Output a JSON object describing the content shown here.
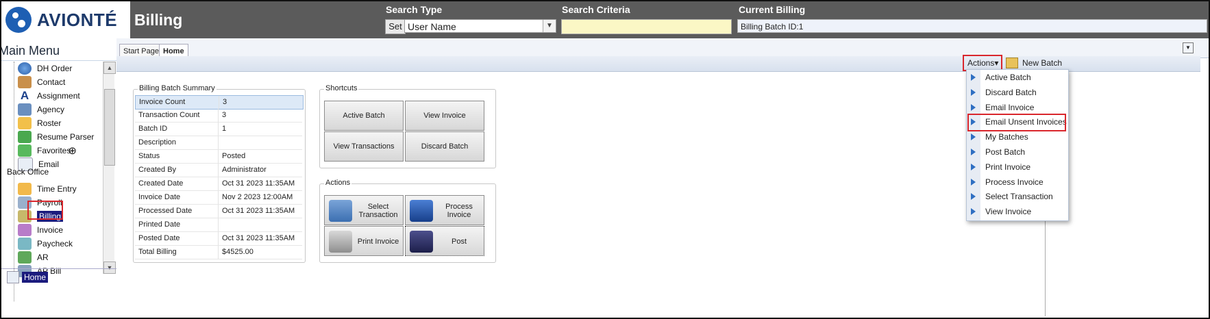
{
  "header": {
    "logo_text": "AVIONTÉ",
    "page_title": "Billing",
    "search_type_label": "Search Type",
    "search_criteria_label": "Search Criteria",
    "current_billing_label": "Current Billing",
    "set_label": "Set",
    "search_type_value": "User Name",
    "current_billing_value": "Billing Batch ID:1"
  },
  "left_menu": {
    "title": "Main Menu",
    "items": [
      {
        "label": "DH Order",
        "icon": "globe-icon"
      },
      {
        "label": "Contact",
        "icon": "contact-icon"
      },
      {
        "label": "Assignment",
        "icon": "assignment-icon"
      },
      {
        "label": "Agency",
        "icon": "agency-icon"
      },
      {
        "label": "Roster",
        "icon": "roster-icon"
      },
      {
        "label": "Resume Parser",
        "icon": "resume-parser-icon"
      },
      {
        "label": "Favorites",
        "icon": "favorites-icon"
      },
      {
        "label": "Email",
        "icon": "email-icon"
      }
    ],
    "group_label": "Back Office",
    "back_office_items": [
      {
        "label": "Time Entry",
        "icon": "time-entry-icon"
      },
      {
        "label": "Payroll",
        "icon": "payroll-icon"
      },
      {
        "label": "Billing",
        "icon": "billing-icon"
      },
      {
        "label": "Invoice",
        "icon": "invoice-icon"
      },
      {
        "label": "Paycheck",
        "icon": "paycheck-icon"
      },
      {
        "label": "AR",
        "icon": "ar-icon"
      },
      {
        "label": "AP Bill",
        "icon": "ap-bill-icon"
      }
    ],
    "home_label": "Home"
  },
  "tabs": [
    {
      "label": "Start Page"
    },
    {
      "label": "Home"
    }
  ],
  "toolbar": {
    "actions_label": "Actions",
    "new_batch_label": "New Batch"
  },
  "summary": {
    "title": "Billing Batch Summary",
    "rows": [
      {
        "key": "Invoice Count",
        "value": "3"
      },
      {
        "key": "Transaction Count",
        "value": "3"
      },
      {
        "key": "Batch ID",
        "value": "1"
      },
      {
        "key": "Description",
        "value": ""
      },
      {
        "key": "Status",
        "value": "Posted"
      },
      {
        "key": "Created By",
        "value": "Administrator"
      },
      {
        "key": "Created Date",
        "value": "Oct 31 2023 11:35AM"
      },
      {
        "key": "Invoice Date",
        "value": "Nov  2 2023 12:00AM"
      },
      {
        "key": "Processed Date",
        "value": "Oct 31 2023 11:35AM"
      },
      {
        "key": "Printed Date",
        "value": ""
      },
      {
        "key": "Posted Date",
        "value": "Oct 31 2023 11:35AM"
      },
      {
        "key": "Total Billing",
        "value": "$4525.00"
      }
    ]
  },
  "shortcuts": {
    "title": "Shortcuts",
    "buttons": [
      "Active Batch",
      "View Invoice",
      "View Transactions",
      "Discard Batch"
    ]
  },
  "actions_panel": {
    "title": "Actions",
    "buttons": [
      "Select Transaction",
      "Process Invoice",
      "Print Invoice",
      "Post"
    ]
  },
  "dropdown": {
    "items": [
      "Active Batch",
      "Discard Batch",
      "Email Invoice",
      "Email Unsent Invoices",
      "My Batches",
      "Post Batch",
      "Print Invoice",
      "Process Invoice",
      "Select Transaction",
      "View Invoice"
    ],
    "highlighted": "Email Unsent Invoices"
  },
  "colors": {
    "header_bg": "#5b5b5b",
    "highlight_box": "#d9262c",
    "selected_menu": "#1b1b7d",
    "brand_blue": "#1e5fb3"
  }
}
